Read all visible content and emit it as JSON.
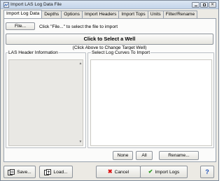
{
  "window": {
    "title": "Import LAS Log Data File",
    "minimize_glyph": "",
    "close_glyph": "✕"
  },
  "tabs": [
    {
      "label": "Import Log Data",
      "active": true
    },
    {
      "label": "Depths",
      "active": false
    },
    {
      "label": "Options",
      "active": false
    },
    {
      "label": "Import Headers",
      "active": false
    },
    {
      "label": "Import Tops",
      "active": false
    },
    {
      "label": "Units",
      "active": false
    },
    {
      "label": "Filter/Rename",
      "active": false
    }
  ],
  "import_panel": {
    "file_button_label": "File...",
    "file_hint": "Click \"File...\" to select the file to import",
    "select_well_label": "Click to Select a Well",
    "change_well_hint": "(Click Above to Change Target Well)",
    "las_header_label": "LAS Header Information",
    "select_curves_label": "Select Log Curves To Import",
    "scroll_up_glyph": "▲",
    "scroll_down_glyph": "▼",
    "none_label": "None",
    "all_label": "All",
    "rename_label": "Rename..."
  },
  "bottom_bar": {
    "save_label": "Save...",
    "load_label": "Load...",
    "cancel_label": "Cancel",
    "import_label": "Import Logs",
    "help_label": "?",
    "cancel_glyph": "✖",
    "import_glyph": "✔"
  },
  "icons": {
    "app": "las-file-icon",
    "save": "save-icon",
    "load": "load-icon",
    "cancel": "cancel-x-icon",
    "import": "checkmark-icon",
    "help": "help-icon"
  },
  "colors": {
    "cancel_x": "#d11111",
    "import_check": "#2a9b1e",
    "help": "#1c4fb8"
  }
}
